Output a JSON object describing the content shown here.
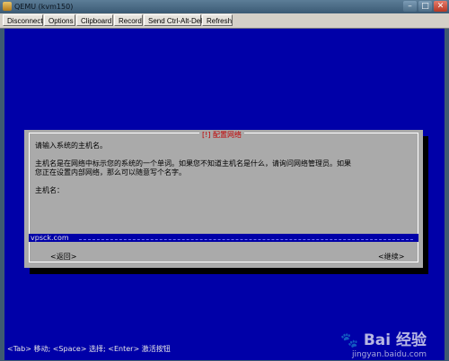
{
  "window": {
    "title": "QEMU (kvm150)",
    "controls": {
      "minimize": "–",
      "maximize": "□",
      "close": "✕"
    }
  },
  "toolbar": {
    "buttons": [
      "Disconnect",
      "Options",
      "Clipboard",
      "Record",
      "Send Ctrl-Alt-Del",
      "Refresh"
    ]
  },
  "installer": {
    "dialog_title": "[!] 配置网络",
    "prompt_line1": "请输入系统的主机名。",
    "prompt_line2": "主机名是在网络中标示您的系统的一个单词。如果您不知道主机名是什么，请询问网络管理员。如果",
    "prompt_line3": "您正在设置内部网络，那么可以随意写个名字。",
    "hostname_label": "主机名：",
    "hostname_value": "vpsck.com",
    "back_button": "<返回>",
    "continue_button": "<继续>",
    "footer_hint": "<Tab> 移动; <Space> 选择; <Enter> 激活按钮"
  },
  "watermark": {
    "logo": "Bai 经验",
    "url": "jingyan.baidu.com"
  }
}
